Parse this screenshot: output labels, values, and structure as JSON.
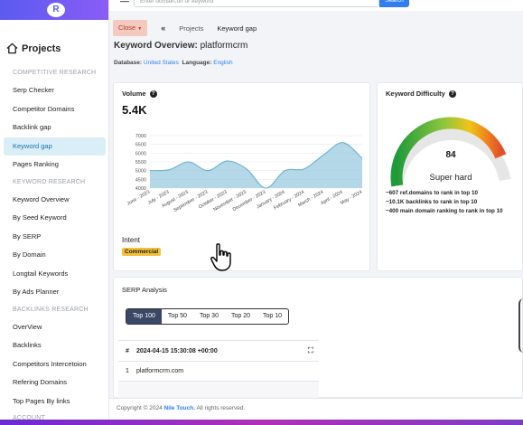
{
  "sidebar": {
    "title": "Projects",
    "sections": [
      {
        "label": "COMPETITIVE RESEARCH",
        "items": [
          "Serp Checker",
          "Competitor Domains",
          "Backlink gap",
          "Keyword gap",
          "Pages Ranking"
        ]
      },
      {
        "label": "KEYWORD RESEARCH",
        "items": [
          "Keyword Overview",
          "By Seed Keyword",
          "By SERP",
          "By Domain",
          "Longtail Keywords",
          "By Ads Planner"
        ]
      },
      {
        "label": "BACKLINKS RESEARCH",
        "items": [
          "OverView",
          "Backlinks",
          "Competitors Intercetoion",
          "Refering Domains",
          "Top Pages By links"
        ]
      },
      {
        "label": "ACCOUNT",
        "items": []
      }
    ],
    "active_item": "Keyword gap"
  },
  "topbar": {
    "search_placeholder": "Enter domain,url or keyword",
    "search_button": "Search"
  },
  "breadcrumb": {
    "close": "Close",
    "back": "«",
    "items": [
      "Projects",
      "Keyword gap"
    ]
  },
  "overview": {
    "title_prefix": "Keyword Overview:",
    "keyword": "platformcrm",
    "database_label": "Database:",
    "database_value": "United States",
    "language_label": "Language:",
    "language_value": "English"
  },
  "volume": {
    "label": "Volume",
    "value": "5.4K",
    "intent_label": "Intent",
    "intent_value": "Commercial"
  },
  "chart_data": {
    "type": "area",
    "categories": [
      "June - 2023",
      "July - 2023",
      "August - 2023",
      "September - 2023",
      "October - 2023",
      "November - 2023",
      "December - 2023",
      "January - 2024",
      "February - 2024",
      "March - 2024",
      "April - 2024",
      "May - 2024"
    ],
    "values": [
      5000,
      5050,
      5500,
      5000,
      5550,
      5100,
      4000,
      5000,
      5100,
      5900,
      6600,
      5700
    ],
    "ylim": [
      4000,
      7000
    ],
    "yticks": [
      4000,
      4500,
      5000,
      5500,
      6000,
      6500,
      7000
    ],
    "grid": true,
    "color": "#9ccbe0"
  },
  "difficulty": {
    "label": "Keyword Difficulty",
    "score": 84,
    "score_fraction": 0.84,
    "level": "Super hard",
    "notes": [
      "~607 ref.domains to rank in top 10",
      "~10.1K backlinks to rank in top 10",
      "~400 main domain ranking to rank in top 10"
    ]
  },
  "serp": {
    "title": "SERP Analysis",
    "tabs": [
      "Top 100",
      "Top 50",
      "Top 30",
      "Top 20",
      "Top 10"
    ],
    "active_tab": "Top 100",
    "table_header_num": "#",
    "table_header_date": "2024-04-15 15:30:08 +00:00",
    "rows": [
      {
        "num": "1",
        "domain": "platformcrm.com"
      }
    ]
  },
  "footer": {
    "prefix": "Copyright © 2024",
    "brand": "Nile Touch.",
    "suffix": "All rights reserved."
  },
  "colors": {
    "accent": "#2f80ed",
    "active_bg": "#d9eef7",
    "intent_badge": "#f3c13a",
    "tab_active": "#3a4866"
  }
}
